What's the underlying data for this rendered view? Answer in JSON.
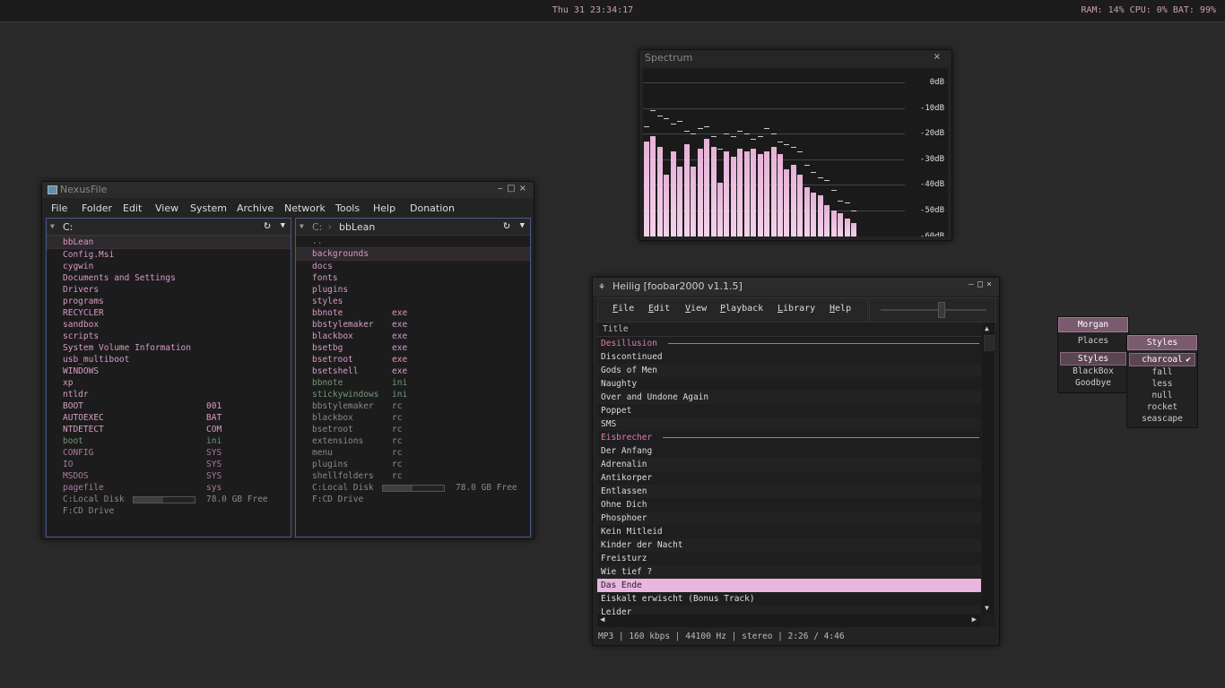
{
  "topbar": {
    "clock": "Thu 31 23:34:17",
    "stats": "RAM: 14% CPU: 0% BAT: 99%"
  },
  "nexusfile": {
    "title": "NexusFile",
    "menu": [
      "File",
      "Folder",
      "Edit",
      "View",
      "System",
      "Archive",
      "Network",
      "Tools",
      "Help",
      "Donation"
    ],
    "left_pane": {
      "drive": "C:",
      "items": [
        {
          "name": "bbLean",
          "ext": "",
          "color": "pink",
          "selected": true
        },
        {
          "name": "Config.Msi",
          "ext": "",
          "color": "pink"
        },
        {
          "name": "cygwin",
          "ext": "",
          "color": "pink"
        },
        {
          "name": "Documents and Settings",
          "ext": "",
          "color": "pink"
        },
        {
          "name": "Drivers",
          "ext": "",
          "color": "pink"
        },
        {
          "name": "programs",
          "ext": "",
          "color": "pink"
        },
        {
          "name": "RECYCLER",
          "ext": "",
          "color": "pink"
        },
        {
          "name": "sandbox",
          "ext": "",
          "color": "pink"
        },
        {
          "name": "scripts",
          "ext": "",
          "color": "pink"
        },
        {
          "name": "System Volume Information",
          "ext": "",
          "color": "pink"
        },
        {
          "name": "usb_multiboot",
          "ext": "",
          "color": "pink"
        },
        {
          "name": "WINDOWS",
          "ext": "",
          "color": "pink"
        },
        {
          "name": "xp",
          "ext": "",
          "color": "pink"
        },
        {
          "name": "ntldr",
          "ext": "",
          "color": "white"
        },
        {
          "name": "BOOT",
          "ext": "001",
          "color": "white"
        },
        {
          "name": "AUTOEXEC",
          "ext": "BAT",
          "color": "pinkwhite"
        },
        {
          "name": "NTDETECT",
          "ext": "COM",
          "color": "white"
        },
        {
          "name": "boot",
          "ext": "ini",
          "color": "green"
        },
        {
          "name": "CONFIG",
          "ext": "SYS",
          "color": "pinkdim"
        },
        {
          "name": "IO",
          "ext": "SYS",
          "color": "pinkdim"
        },
        {
          "name": "MSDOS",
          "ext": "SYS",
          "color": "pinkdim"
        },
        {
          "name": "pagefile",
          "ext": "sys",
          "color": "pinkdim"
        }
      ],
      "disk_label": "C:Local Disk",
      "disk_free": "78.0 GB Free",
      "disk_used_fraction": 0.48,
      "cd_label": "F:CD Drive"
    },
    "right_pane": {
      "drive": "C:",
      "folder": "bbLean",
      "items": [
        {
          "name": "..",
          "ext": "",
          "color": "grey"
        },
        {
          "name": "backgrounds",
          "ext": "",
          "color": "pink",
          "selected": true
        },
        {
          "name": "docs",
          "ext": "",
          "color": "pink"
        },
        {
          "name": "fonts",
          "ext": "",
          "color": "pink"
        },
        {
          "name": "plugins",
          "ext": "",
          "color": "pink"
        },
        {
          "name": "styles",
          "ext": "",
          "color": "pink"
        },
        {
          "name": "bbnote",
          "ext": "exe",
          "color": "pink"
        },
        {
          "name": "bbstylemaker",
          "ext": "exe",
          "color": "pink"
        },
        {
          "name": "blackbox",
          "ext": "exe",
          "color": "pink"
        },
        {
          "name": "bsetbg",
          "ext": "exe",
          "color": "pink"
        },
        {
          "name": "bsetroot",
          "ext": "exe",
          "color": "pink"
        },
        {
          "name": "bsetshell",
          "ext": "exe",
          "color": "pink"
        },
        {
          "name": "bbnote",
          "ext": "ini",
          "color": "green"
        },
        {
          "name": "stickywindows",
          "ext": "ini",
          "color": "green"
        },
        {
          "name": "bbstylemaker",
          "ext": "rc",
          "color": "grey"
        },
        {
          "name": "blackbox",
          "ext": "rc",
          "color": "grey"
        },
        {
          "name": "bsetroot",
          "ext": "rc",
          "color": "grey"
        },
        {
          "name": "extensions",
          "ext": "rc",
          "color": "grey"
        },
        {
          "name": "menu",
          "ext": "rc",
          "color": "grey"
        },
        {
          "name": "plugins",
          "ext": "rc",
          "color": "grey"
        },
        {
          "name": "shellfolders",
          "ext": "rc",
          "color": "grey"
        }
      ],
      "disk_label": "C:Local Disk",
      "disk_free": "78.0 GB Free",
      "disk_used_fraction": 0.48,
      "cd_label": "F:CD Drive"
    }
  },
  "spectrum": {
    "title": "Spectrum",
    "close": "×",
    "db_labels": [
      "0dB",
      "-10dB",
      "-20dB",
      "-30dB",
      "-40dB",
      "-50dB",
      "-60dB"
    ],
    "bars_db": [
      -23,
      -21,
      -25,
      -36,
      -27,
      -33,
      -24,
      -33,
      -26,
      -22,
      -25,
      -39,
      -27,
      -29,
      -26,
      -27,
      -26,
      -28,
      -27,
      -25,
      -28,
      -34,
      -32,
      -36,
      -41,
      -43,
      -44,
      -48,
      -50,
      -51,
      -53,
      -55
    ],
    "peaks_db": [
      -17,
      -11,
      -13,
      -14,
      -16,
      -15,
      -19,
      -20,
      -18,
      -17,
      -21,
      -26,
      -20,
      -21,
      -19,
      -20,
      -22,
      -21,
      -18,
      -20,
      -23,
      -24,
      -25,
      -27,
      -32,
      -35,
      -37,
      -38,
      -42,
      -46,
      -47,
      -50
    ]
  },
  "foobar": {
    "title": "Heilig  [foobar2000 v1.1.5]",
    "menu": [
      "File",
      "Edit",
      "View",
      "Playback",
      "Library",
      "Help"
    ],
    "column_title": "Title",
    "rows": [
      {
        "type": "group",
        "text": "Desillusion"
      },
      {
        "type": "track",
        "text": "Discontinued"
      },
      {
        "type": "track",
        "text": "Gods of Men"
      },
      {
        "type": "track",
        "text": "Naughty"
      },
      {
        "type": "track",
        "text": "Over and Undone Again"
      },
      {
        "type": "track",
        "text": "Poppet"
      },
      {
        "type": "track",
        "text": "SMS"
      },
      {
        "type": "group",
        "text": "Eisbrecher"
      },
      {
        "type": "track",
        "text": "Der Anfang"
      },
      {
        "type": "track",
        "text": "Adrenalin"
      },
      {
        "type": "track",
        "text": "Antikorper"
      },
      {
        "type": "track",
        "text": "Entlassen"
      },
      {
        "type": "track",
        "text": "Ohne Dich"
      },
      {
        "type": "track",
        "text": "Phosphoer"
      },
      {
        "type": "track",
        "text": "Kein Mitleid"
      },
      {
        "type": "track",
        "text": "Kinder der Nacht"
      },
      {
        "type": "track",
        "text": "Freisturz"
      },
      {
        "type": "track",
        "text": "Wie tief ?"
      },
      {
        "type": "now",
        "text": "Das Ende"
      },
      {
        "type": "track",
        "text": "Eiskalt erwischt (Bonus Track)"
      },
      {
        "type": "track",
        "text": "Leider"
      }
    ],
    "seek_fraction": 0.57,
    "status": "MP3 | 160 kbps | 44100 Hz | stereo | 2:26 / 4:46"
  },
  "menus": {
    "root": {
      "title": "Morgan",
      "items": [
        "Places",
        "Styles",
        "BlackBox",
        "Goodbye"
      ],
      "highlight": "Styles"
    },
    "styles": {
      "title": "Styles",
      "items": [
        "charcoal",
        "fall",
        "less",
        "null",
        "rocket",
        "seascape"
      ],
      "checked": "charcoal"
    }
  }
}
